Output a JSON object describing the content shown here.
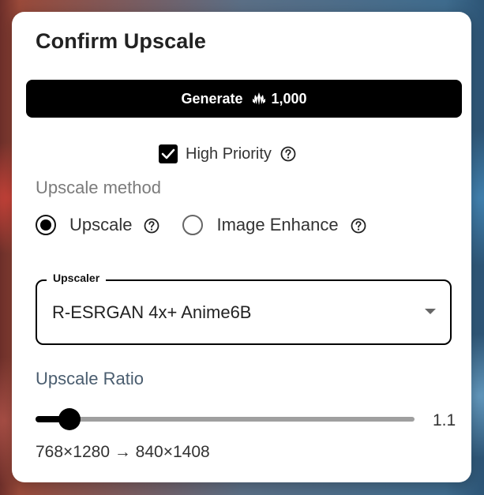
{
  "dialog": {
    "title": "Confirm Upscale",
    "generate": {
      "label": "Generate",
      "cost": "1,000",
      "cost_icon": "anlas-icon"
    },
    "high_priority": {
      "label": "High Priority",
      "checked": true
    },
    "upscale_method": {
      "label": "Upscale method",
      "options": [
        {
          "label": "Upscale",
          "selected": true
        },
        {
          "label": "Image Enhance",
          "selected": false
        }
      ]
    },
    "upscaler": {
      "legend": "Upscaler",
      "value": "R-ESRGAN 4x+ Anime6B"
    },
    "upscale_ratio": {
      "label": "Upscale Ratio",
      "value": "1.1",
      "slider_fraction": 0.09
    },
    "resolution": "768×1280 → 840×1408"
  }
}
